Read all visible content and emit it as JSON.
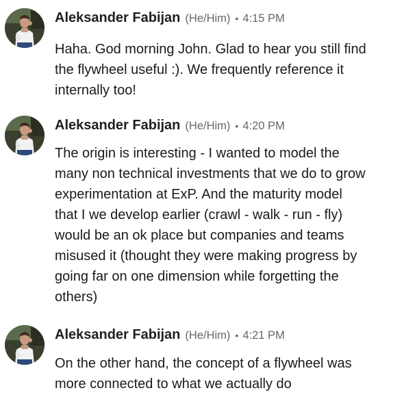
{
  "messages": [
    {
      "author": "Aleksander Fabijan",
      "pronouns": "(He/Him)",
      "separator": "•",
      "time": "4:15 PM",
      "text": "Haha. God morning John. Glad to hear you still find\nthe flywheel useful :). We frequently reference it\ninternally too!"
    },
    {
      "author": "Aleksander Fabijan",
      "pronouns": "(He/Him)",
      "separator": "•",
      "time": "4:20 PM",
      "text": "The origin is interesting - I wanted to model the\nmany non technical investments that we do to grow\nexperimentation at ExP. And the maturity model\nthat I we develop earlier (crawl - walk - run - fly)\nwould be an ok place but companies and teams\nmisused it (thought they were making progress by\ngoing far on one dimension while forgetting the\nothers)"
    },
    {
      "author": "Aleksander Fabijan",
      "pronouns": "(He/Him)",
      "separator": "•",
      "time": "4:21 PM",
      "text": "On the other hand, the concept of a flywheel was\nmore connected to what we actually do"
    }
  ]
}
